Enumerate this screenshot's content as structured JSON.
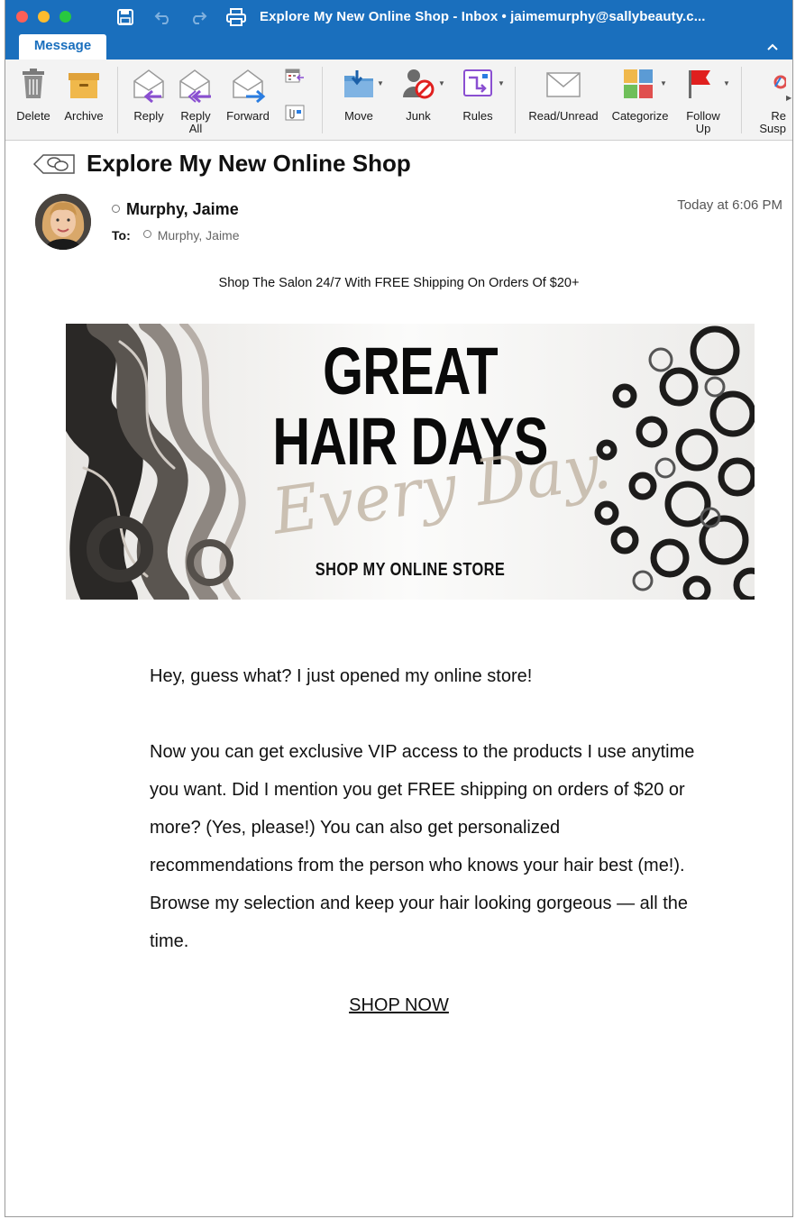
{
  "window": {
    "title": "Explore My New Online Shop - Inbox • jaimemurphy@sallybeauty.c..."
  },
  "ribbon": {
    "active_tab": "Message",
    "buttons": {
      "delete": "Delete",
      "archive": "Archive",
      "reply": "Reply",
      "reply_all_1": "Reply",
      "reply_all_2": "All",
      "forward": "Forward",
      "move": "Move",
      "junk": "Junk",
      "rules": "Rules",
      "read_unread": "Read/Unread",
      "categorize": "Categorize",
      "follow_up_1": "Follow",
      "follow_up_2": "Up",
      "report_1": "Re",
      "report_2": "Susp"
    }
  },
  "message": {
    "subject": "Explore My New Online Shop",
    "sender": "Murphy, Jaime",
    "to_label": "To:",
    "to": "Murphy, Jaime",
    "timestamp": "Today at 6:06 PM"
  },
  "email": {
    "preheader": "Shop The Salon 24/7 With FREE Shipping On Orders Of $20+",
    "banner": {
      "line1": "GREAT",
      "line2": "HAIR DAYS",
      "script": "Every Day.",
      "cta": "SHOP MY ONLINE STORE"
    },
    "paragraph1": "Hey, guess what? I just opened my online store!",
    "paragraph2": "Now you can get exclusive VIP access to the products I use anytime you want. Did I mention you get FREE shipping on orders of $20 or more? (Yes, please!) You can also get personalized recommendations from the person who knows your hair best (me!). Browse my selection and keep your hair looking gorgeous — all the time.",
    "shop_now": "SHOP NOW"
  },
  "colors": {
    "titlebar": "#1a6fbd",
    "ribbon_bg": "#f3f3f3",
    "flag_red": "#e0201f"
  },
  "icons": [
    "save-icon",
    "undo-icon",
    "redo-icon",
    "print-icon",
    "trash-icon",
    "archive-box-icon",
    "reply-icon",
    "reply-all-icon",
    "forward-icon",
    "meeting-icon",
    "attachment-icon",
    "move-folder-icon",
    "junk-icon",
    "rules-icon",
    "envelope-icon",
    "categorize-icon",
    "flag-icon",
    "conversation-icon"
  ]
}
